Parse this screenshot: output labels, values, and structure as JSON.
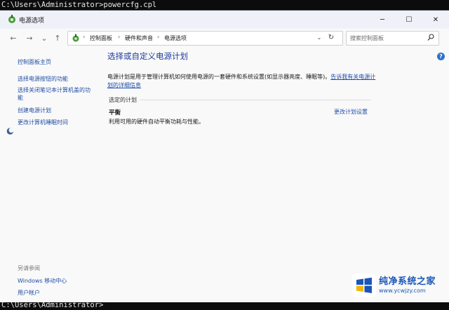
{
  "console": {
    "top_line": "C:\\Users\\Administrator>powercfg.cpl",
    "bottom_line": "C:\\Users\\Administrator>"
  },
  "window": {
    "title": "电源选项",
    "controls": {
      "minimize": "─",
      "maximize": "☐",
      "close": "✕"
    }
  },
  "nav": {
    "back": "←",
    "forward": "→",
    "recent": "⌄",
    "up": "↑",
    "breadcrumbs": [
      "控制面板",
      "硬件和声音",
      "电源选项"
    ],
    "separator": "›",
    "dropdown": "⌄",
    "refresh": "↻",
    "search_placeholder": "搜索控制面板"
  },
  "sidebar": {
    "home": "控制面板主页",
    "items": [
      "选择电源按钮的功能",
      "选择关闭笔记本计算机盖的功能",
      "创建电源计划",
      "更改计算机睡眠时间"
    ],
    "see_also_title": "另请参阅",
    "see_also": [
      "Windows 移动中心",
      "用户帐户"
    ]
  },
  "main": {
    "heading": "选择或自定义电源计划",
    "description": "电源计划是用于管理计算机如何使用电源的一套硬件和系统设置(如显示器亮度、睡眠等)。",
    "description_link": "告诉我有关电源计划的详细信息",
    "section_label": "选定的计划",
    "plan": {
      "name": "平衡",
      "description": "利用可用的硬件自动平衡功耗与性能。",
      "change_link": "更改计划设置"
    }
  },
  "help_icon": "?",
  "watermark": {
    "title": "纯净系统之家",
    "url": "www.ycwjzy.com",
    "colors": {
      "brand": "#1b56b8",
      "accent": "#f2b705"
    }
  }
}
